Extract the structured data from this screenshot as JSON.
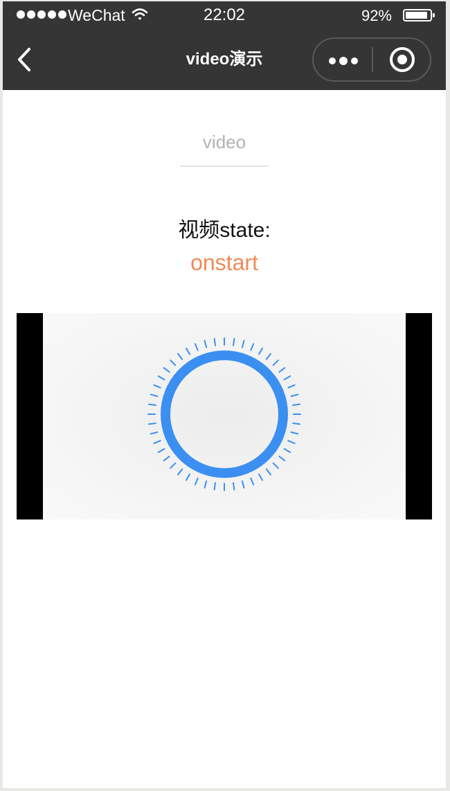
{
  "status_bar": {
    "carrier": "WeChat",
    "time": "22:02",
    "battery_percent": "92%",
    "battery_level": 0.92
  },
  "nav": {
    "title": "video演示",
    "back_icon": "chevron-left-icon",
    "more_icon": "more-dots-icon",
    "close_icon": "target-close-icon"
  },
  "page": {
    "heading": "video",
    "state_label": "视频state:",
    "state_value": "onstart"
  },
  "colors": {
    "nav_background": "#353535",
    "state_value": "#f08a58",
    "heading": "#b2b2b2",
    "video_ring": "#3b8ff0"
  },
  "video": {
    "icon": "loading-ring-icon"
  }
}
